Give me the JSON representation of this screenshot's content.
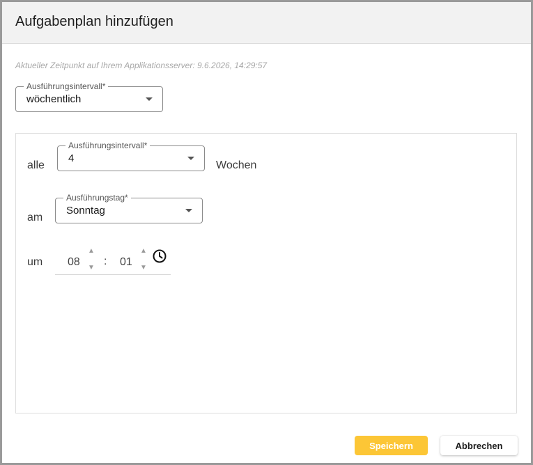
{
  "dialog": {
    "title": "Aufgabenplan hinzufügen",
    "server_time_text": "Aktueller Zeitpunkt auf Ihrem Applikationsserver: 9.6.2026, 14:29:57"
  },
  "interval_type": {
    "label": "Ausführungsintervall*",
    "value": "wöchentlich"
  },
  "schedule": {
    "every_prefix": "alle",
    "interval": {
      "label": "Ausführungsintervall*",
      "value": "4"
    },
    "every_suffix": "Wochen",
    "on_prefix": "am",
    "weekday": {
      "label": "Ausführungstag*",
      "value": "Sonntag"
    },
    "at_prefix": "um",
    "time": {
      "hours": "08",
      "separator": ":",
      "minutes": "01"
    }
  },
  "spinner": {
    "up": "▲",
    "down": "▼"
  },
  "icons": {
    "clock": "clock-icon",
    "dropdown": "chevron-down-icon"
  },
  "actions": {
    "save_label": "Speichern",
    "cancel_label": "Abbrechen"
  },
  "colors": {
    "primary": "#fcc636",
    "header_bg": "#f2f2f2",
    "frame": "#9a9a9a"
  }
}
